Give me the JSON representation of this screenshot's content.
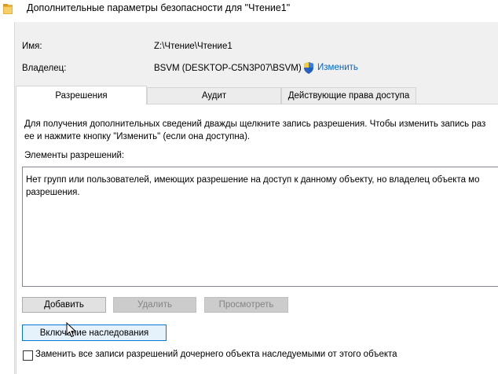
{
  "window": {
    "title": "Дополнительные параметры безопасности  для \"Чтение1\""
  },
  "info": {
    "name_label": "Имя:",
    "name_value": "Z:\\Чтение\\Чтение1",
    "owner_label": "Владелец:",
    "owner_value": "BSVM (DESKTOP-C5N3P07\\BSVM)",
    "owner_change_link": "Изменить"
  },
  "tabs": [
    {
      "label": "Разрешения",
      "active": true
    },
    {
      "label": "Аудит",
      "active": false
    },
    {
      "label": "Действующие права доступа",
      "active": false
    }
  ],
  "permissions": {
    "description_line1": "Для получения дополнительных сведений дважды щелкните запись разрешения. Чтобы изменить запись раз",
    "description_line2": "ее и нажмите кнопку \"Изменить\" (если она доступна).",
    "elements_label": "Элементы разрешений:",
    "list_message_line1": "Нет групп или пользователей, имеющих разрешение на доступ к данному объекту, но владелец объекта мо",
    "list_message_line2": "разрешения.",
    "buttons": {
      "add": "Добавить",
      "remove": "Удалить",
      "view": "Просмотреть"
    },
    "inheritance_button": "Включение наследования",
    "replace_checkbox_label": "Заменить все записи разрешений дочернего объекта наследуемыми от этого объекта"
  },
  "colors": {
    "link": "#0066cc",
    "focus_border": "#0078d7",
    "dialog_bg": "#f0f0f0"
  },
  "icons": {
    "title": "folder-icon",
    "owner_change": "uac-shield-icon",
    "pointer": "mouse-cursor-icon"
  }
}
